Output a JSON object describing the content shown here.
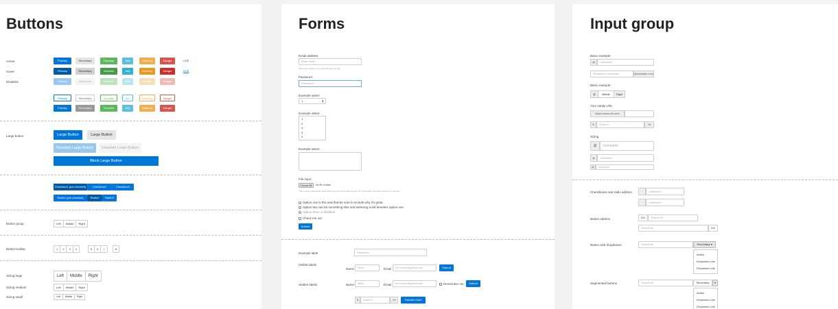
{
  "buttons": {
    "title": "Buttons",
    "row_labels": {
      "active": "Active",
      "hover": "Hover",
      "disabled": "Disabled"
    },
    "variants": [
      "Primary",
      "Secondary",
      "Success",
      "Info",
      "Warning",
      "Danger"
    ],
    "link_label": "Link",
    "large_label": "Large button",
    "large_primary": "Large Button",
    "large_secondary": "Large Button",
    "disabled_large_primary": "Disabled Large Button",
    "disabled_large_secondary": "Disabled Large Button",
    "block_large": "Block Large Button",
    "checkboxes": [
      "Checkbox1 (pre-checked)",
      "Checkbox2",
      "Checkbox3"
    ],
    "radios": [
      "Radio1 (pre-checked)",
      "Radio2",
      "Radio3"
    ],
    "group_label": "Button group",
    "group": [
      "Left",
      "Middle",
      "Right"
    ],
    "toolbar_label": "Button toolbar",
    "toolbar_groups": [
      [
        "1",
        "2",
        "3",
        "4"
      ],
      [
        "5",
        "6",
        "7"
      ],
      [
        "8"
      ]
    ],
    "sizing_large_label": "Sizing large",
    "sizing_medium_label": "Sizing medium",
    "sizing_small_label": "Sizing small",
    "sizing": [
      "Left",
      "Middle",
      "Right"
    ]
  },
  "forms": {
    "title": "Forms",
    "email_label": "Email address",
    "email_placeholder": "Enter email",
    "email_help": "We'll never share your email with anyone else.",
    "password_label": "Password",
    "password_placeholder": "Password",
    "select_label": "Example select",
    "select_value": "1",
    "multi_label": "Example select",
    "multi_options": [
      "1",
      "2",
      "3",
      "4",
      "5"
    ],
    "textarea_label": "Example select",
    "file_label": "File input",
    "file_button": "Choose file",
    "file_status": "No file chosen",
    "file_help": "This is some placeholder block-level help text for the above input. It's a bit lighter and easily wraps to a new line.",
    "radios": [
      "Option one is this and that-be sure to include why it's great",
      "Option two can be something else and selecting it will deselect option one",
      "Option three is disabled"
    ],
    "check_label": "Check me out",
    "submit": "Submit",
    "example_table_label": "Example label",
    "example_table_placeholder": "Password",
    "visible_label": "Visible labels",
    "name_label": "Name",
    "name_placeholder": "Miles",
    "email2_label": "Email",
    "email2_placeholder": "ed.morton@gmail.com",
    "submit2": "Submit",
    "hidden_label": "Hidden labels",
    "remember": "Remember me",
    "submit3": "Submit",
    "amount_prefix": "$",
    "amount_placeholder": "Amount",
    "amount_suffix": ".00",
    "transfer": "Transfer Cash"
  },
  "input_group": {
    "title": "Input group",
    "basic_label": "Basic example",
    "at": "@",
    "username": "Username",
    "recipient": "Recipient's username",
    "example_com": "@example.com",
    "basic2_label": "Basic example",
    "left": "Left",
    "middle": "Middle",
    "right": "Right",
    "vanity_label": "Your vanity URL",
    "vanity_prefix": "https://www.ult.com/",
    "dollar": "$",
    "amount": "Amount",
    "cents": ".00",
    "sizing_label": "Sizing",
    "checks_label": "Checkboxes and radio addons",
    "button_addons_label": "Button addons",
    "go": "Go!",
    "search_for": "Search for",
    "dropdown_label": "Button with dropdowns",
    "secondary": "Secondary",
    "menu": [
      "Action",
      "Dropdown Link",
      "Dropdown Link"
    ],
    "segmented_label": "Segmented buttons"
  }
}
